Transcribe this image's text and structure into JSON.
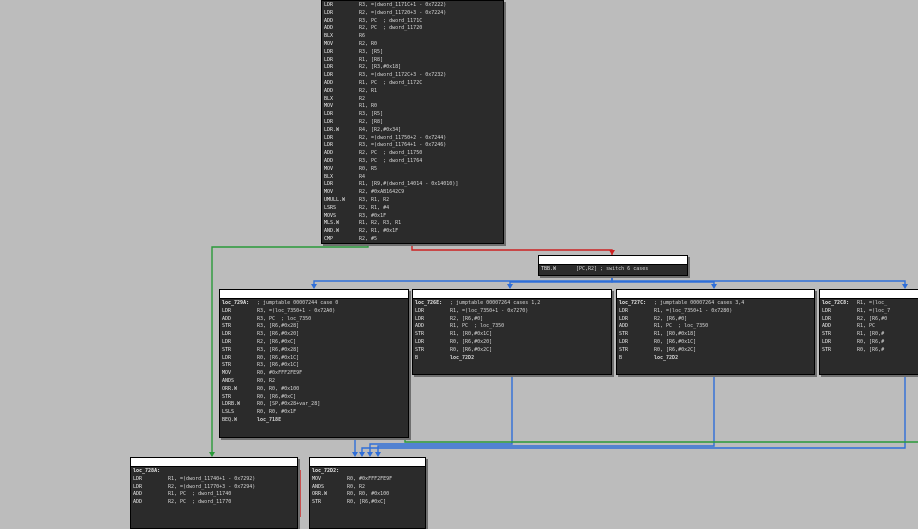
{
  "colors": {
    "canvas": "#bcbcbc",
    "block_bg": "#2b2b2b",
    "label": "#f0c040",
    "comment": "#8a8a8a",
    "immediate": "#ff6b4a",
    "edge_true": "#2a9a3a",
    "edge_false": "#cc2222",
    "edge_switch": "#2f6ed8"
  },
  "blocks": {
    "top": {
      "lines": [
        [
          "LDR",
          "R3, =(dword_1171C+1 - 0x7222)"
        ],
        [
          "LDR",
          "R2, =(dword_11720+3 - 0x7224)"
        ],
        [
          "ADD",
          "R3, PC  ; dword_1171C"
        ],
        [
          "ADD",
          "R2, PC  ; dword_11720"
        ],
        [
          "BLX",
          "R6"
        ],
        [
          "MOV",
          "R2, R0"
        ],
        [
          "LDR",
          "R3, [R5]"
        ],
        [
          "LDR",
          "R1, [R8]"
        ],
        [
          "LDR",
          "R2, [R3,#0x18]"
        ],
        [
          "LDR",
          "R3, =(dword_1172C+3 - 0x7232)"
        ],
        [
          "ADD",
          "R1, PC  ; dword_1172C"
        ],
        [
          "ADD",
          "R2, R1"
        ],
        [
          "BLX",
          "R2"
        ],
        [
          "MOV",
          "R1, R0"
        ],
        [
          "LDR",
          "R3, [R5]"
        ],
        [
          "LDR",
          "R2, [R8]"
        ],
        [
          "LDR.W",
          "R4, [R2,#0x34]"
        ],
        [
          "LDR",
          "R2, =(dword_11750+2 - 0x7244)"
        ],
        [
          "LDR",
          "R3, =(dword_11764+1 - 0x7246)"
        ],
        [
          "ADD",
          "R2, PC  ; dword_11750"
        ],
        [
          "ADD",
          "R3, PC  ; dword_11764"
        ],
        [
          "MOV",
          "R0, R5"
        ],
        [
          "BLX",
          "R4"
        ],
        [
          "LDR",
          "R1, [R9,#(dword_14014 - 0x14010)]"
        ],
        [
          "MOV",
          "R2, #0xAB1642C9"
        ],
        [
          "UMULL.W",
          "R3, R1, R2"
        ],
        [
          "LSRS",
          "R2, R1, #4"
        ],
        [
          "MOVS",
          "R3, #0x1F"
        ],
        [
          "MLS.W",
          "R1, R2, R3, R1"
        ],
        [
          "AND.W",
          "R2, R1, #0x1F"
        ],
        [
          "CMP",
          "R2, #5"
        ],
        [
          "BHI",
          "loc_728A"
        ]
      ]
    },
    "switch": {
      "lines": [
        [
          "TBB.W",
          "[PC,R2] ; switch 6 cases"
        ]
      ]
    },
    "b729a": {
      "lines": [
        [
          "loc_729A:",
          "; jumptable 00007244 case 0"
        ],
        [
          "LDR",
          "R3, =(loc_7350+1 - 0x72A0)"
        ],
        [
          "ADD",
          "R3, PC  ; loc_7350"
        ],
        [
          "STR",
          "R3, [R6,#0x28]"
        ],
        [
          "LDR",
          "R3, [R6,#0x20]"
        ],
        [
          "LDR",
          "R2, [R6,#0xC]"
        ],
        [
          "STR",
          "R3, [R6,#0x28]"
        ],
        [
          "LDR",
          "R0, [R6,#0x1C]"
        ],
        [
          "STR",
          "R3, [R6,#0x1C]"
        ],
        [
          "MOV",
          "R0, #0xFFF2FE9F"
        ],
        [
          "ANDS",
          "R0, R2"
        ],
        [
          "ORR.W",
          "R0, R0, #0x100"
        ],
        [
          "STR",
          "R0, [R6,#0xC]"
        ],
        [
          "LDRB.W",
          "R0, [SP,#0x28+var_28]"
        ],
        [
          "LSLS",
          "R0, R0, #0x1F"
        ],
        [
          "BEQ.W",
          "loc_718E"
        ]
      ]
    },
    "b726e": {
      "lines": [
        [
          "loc_726E:",
          "; jumptable 00007264 cases 1,2"
        ],
        [
          "LDR",
          "R1, =(loc_7350+1 - 0x7270)"
        ],
        [
          "LDR",
          "R2, [R6,#0]"
        ],
        [
          "ADD",
          "R1, PC  ; loc_7350"
        ],
        [
          "STR",
          "R1, [R0,#0x1C]"
        ],
        [
          "LDR",
          "R0, [R6,#0x20]"
        ],
        [
          "STR",
          "R0, [R6,#0x2C]"
        ],
        [
          "B",
          "loc_72D2"
        ]
      ]
    },
    "b727c": {
      "lines": [
        [
          "loc_727C:",
          "; jumptable 00007264 cases 3,4"
        ],
        [
          "LDR",
          "R1, =(loc_7350+1 - 0x7280)"
        ],
        [
          "LDR",
          "R2, [R6,#0]"
        ],
        [
          "ADD",
          "R1, PC  ; loc_7350"
        ],
        [
          "STR",
          "R1, [R0,#0x18]"
        ],
        [
          "LDR",
          "R0, [R6,#0x1C]"
        ],
        [
          "STR",
          "R0, [R6,#0x2C]"
        ],
        [
          "B",
          "loc_72D2"
        ]
      ]
    },
    "b72c8": {
      "lines": [
        [
          "loc_72C8:",
          "R1, =(loc_"
        ],
        [
          "LDR",
          "R1, =(loc_7"
        ],
        [
          "LDR",
          "R2, [R6,#0"
        ],
        [
          "ADD",
          "R1, PC"
        ],
        [
          "STR",
          "R1, [R0,#"
        ],
        [
          "LDR",
          "R0, [R6,#"
        ],
        [
          "STR",
          "R0, [R6,#"
        ]
      ]
    },
    "b728a": {
      "lines": [
        [
          "loc_728A:",
          ""
        ],
        [
          "LDR",
          "R1, =(dword_11740+1 - 0x7292)"
        ],
        [
          "LDR",
          "R2, =(dword_11770+3 - 0x7294)"
        ],
        [
          "ADD",
          "R1, PC  ; dword_11740"
        ],
        [
          "ADD",
          "R2, PC  ; dword_11770"
        ]
      ]
    },
    "b72d2": {
      "lines": [
        [
          "loc_72D2:",
          ""
        ],
        [
          "MOV",
          "R0, #0xFFF2FE9F"
        ],
        [
          "ANDS",
          "R0, R2"
        ],
        [
          "ORR.W",
          "R0, R0, #0x100"
        ],
        [
          "STR",
          "R0, [R6,#0xC]"
        ]
      ]
    }
  }
}
